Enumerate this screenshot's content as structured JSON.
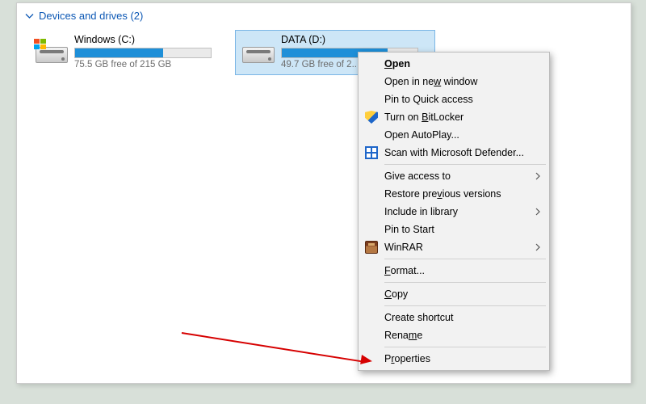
{
  "section": {
    "title": "Devices and drives (2)"
  },
  "drives": [
    {
      "title": "Windows (C:)",
      "free_text": "75.5 GB free of 215 GB",
      "fill_percent": 65,
      "os_flag": true,
      "selected": false
    },
    {
      "title": "DATA (D:)",
      "free_text": "49.7 GB free of 2...",
      "fill_percent": 78,
      "os_flag": false,
      "selected": true
    }
  ],
  "context_menu": {
    "groups": [
      [
        {
          "label": "Open",
          "bold": true,
          "access": "O"
        },
        {
          "label": "Open in new window",
          "access": "w"
        },
        {
          "label": "Pin to Quick access"
        },
        {
          "label": "Turn on BitLocker",
          "access": "B",
          "icon": "shield"
        },
        {
          "label": "Open AutoPlay..."
        },
        {
          "label": "Scan with Microsoft Defender...",
          "icon": "defender"
        }
      ],
      [
        {
          "label": "Give access to",
          "submenu": true
        },
        {
          "label": "Restore previous versions",
          "access": "v"
        },
        {
          "label": "Include in library",
          "submenu": true
        },
        {
          "label": "Pin to Start"
        },
        {
          "label": "WinRAR",
          "submenu": true,
          "icon": "winrar"
        }
      ],
      [
        {
          "label": "Format...",
          "access": "F"
        }
      ],
      [
        {
          "label": "Copy",
          "access": "C"
        }
      ],
      [
        {
          "label": "Create shortcut"
        },
        {
          "label": "Rename",
          "access": "m"
        }
      ],
      [
        {
          "label": "Properties",
          "access": "r"
        }
      ]
    ]
  }
}
